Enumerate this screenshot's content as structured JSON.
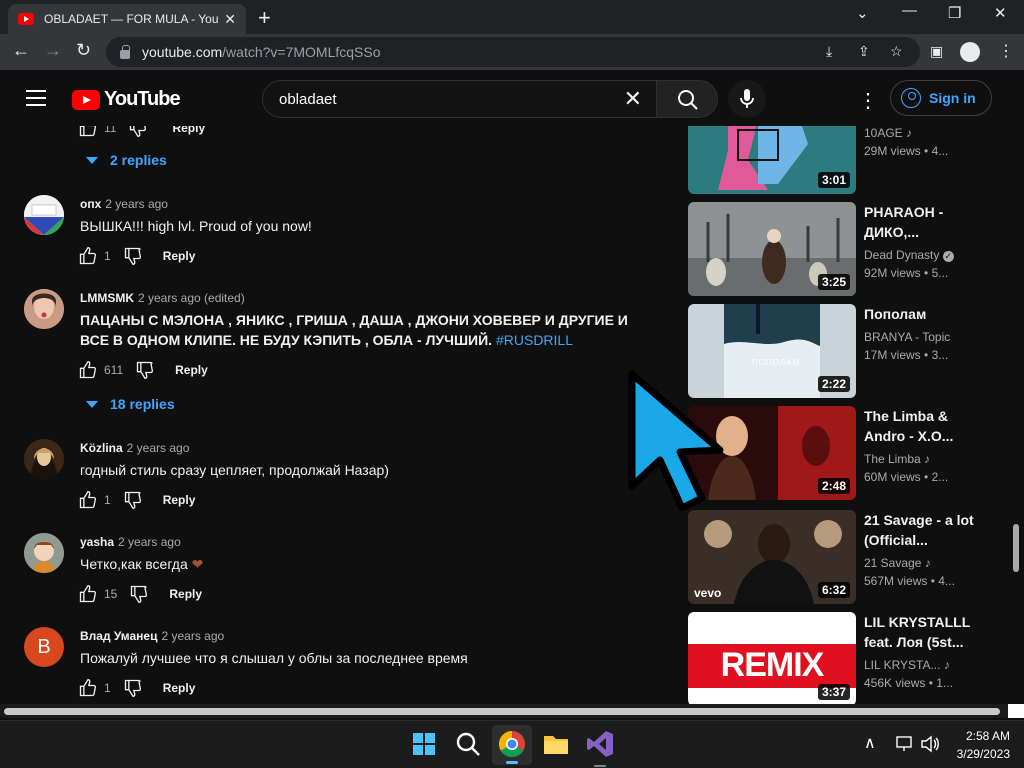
{
  "browser": {
    "tab_title": "OBLADAET — FOR MULA - YouTube",
    "url_host": "youtube.com",
    "url_path": "/watch?v=7MOMLfcqSSo"
  },
  "youtube": {
    "logo_text": "YouTube",
    "search_query": "obladaet",
    "signin_label": "Sign in"
  },
  "comments": {
    "top_partial": {
      "likes": "11",
      "reply_label": "Reply"
    },
    "top_replies_label": "2 replies",
    "items": [
      {
        "author": "опх",
        "time": "2 years ago",
        "text": "ВЫШКА!!! high lvl. Proud of you now!",
        "likes": "1",
        "reply_label": "Reply"
      },
      {
        "author": "LMMSMK",
        "time": "2 years ago (edited)",
        "text": "ПАЦАНЫ С МЭЛОНА , ЯНИКС , ГРИША , ДАША , ДЖОНИ ХОВЕВЕР И ДРУГИЕ И ВСЕ В ОДНОМ КЛИПЕ. НЕ БУДУ КЭПИТЬ , ОБЛА - ЛУЧШИЙ.",
        "hashtag": "#RUSDRILL",
        "likes": "611",
        "reply_label": "Reply",
        "replies_label": "18 replies"
      },
      {
        "author": "Közlina",
        "time": "2 years ago",
        "text": "годный стиль сразу цепляет, продолжай Назар)",
        "likes": "1",
        "reply_label": "Reply"
      },
      {
        "author": "yasha",
        "time": "2 years ago",
        "text": "Четко,как всегда",
        "likes": "15",
        "reply_label": "Reply"
      },
      {
        "author": "Влад Уманец",
        "time": "2 years ago",
        "text": "Пожалуй лучшее что я слышал у облы за последнее время",
        "likes": "1",
        "reply_label": "Reply",
        "avatar_letter": "B"
      }
    ]
  },
  "sidebar": {
    "videos": [
      {
        "title": "",
        "channel": "10AGE",
        "views": "29M views",
        "age": "4...",
        "duration": "3:01",
        "badge": "music-note-icon"
      },
      {
        "title": "PHARAOH - ДИКО,...",
        "channel": "Dead Dynasty",
        "views": "92M views",
        "age": "5...",
        "duration": "3:25",
        "badge": "verified-icon"
      },
      {
        "title": "Пополам",
        "channel": "BRANYA - Topic",
        "views": "17M views",
        "age": "3...",
        "duration": "2:22",
        "thumb_text": "ПОПОЛАМ"
      },
      {
        "title": "The Limba & Andro - X.O...",
        "channel": "The Limba",
        "views": "60M views",
        "age": "2...",
        "duration": "2:48",
        "badge": "music-note-icon"
      },
      {
        "title": "21 Savage - a lot (Official...",
        "channel": "21 Savage",
        "views": "567M views",
        "age": "4...",
        "duration": "6:32",
        "badge": "music-note-icon",
        "thumb_text": "vevo"
      },
      {
        "title": "LIL KRYSTALLL feat. Лоя (5st...",
        "channel": "LIL KRYSTA...",
        "views": "456K views",
        "age": "1...",
        "duration": "3:37",
        "badge": "music-note-icon",
        "thumb_text": "REMIX"
      }
    ]
  },
  "taskbar": {
    "time": "2:58 AM",
    "date": "3/29/2023"
  },
  "colors": {
    "yt_red": "#ff0000",
    "link_blue": "#3ea6ff",
    "cursor_blue": "#1aa8e8"
  }
}
